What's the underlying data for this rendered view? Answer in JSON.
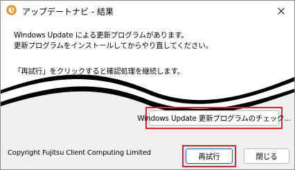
{
  "window": {
    "title": "アップデートナビ - 結果"
  },
  "message": {
    "line1": "Windows Update による更新プログラムがあります。",
    "line2": "更新プログラムをインストールしてからやり直してください。",
    "line3": "「再試行」をクリックすると確認処理を継続します。"
  },
  "buttons": {
    "check_updates": "Windows Update 更新プログラムのチェック...",
    "retry": "再試行",
    "close": "閉じる"
  },
  "footer": {
    "copyright": "Copyright Fujitsu Client Computing Limited"
  },
  "colors": {
    "highlight": "#e0202a",
    "primary_border": "#0067c0"
  }
}
